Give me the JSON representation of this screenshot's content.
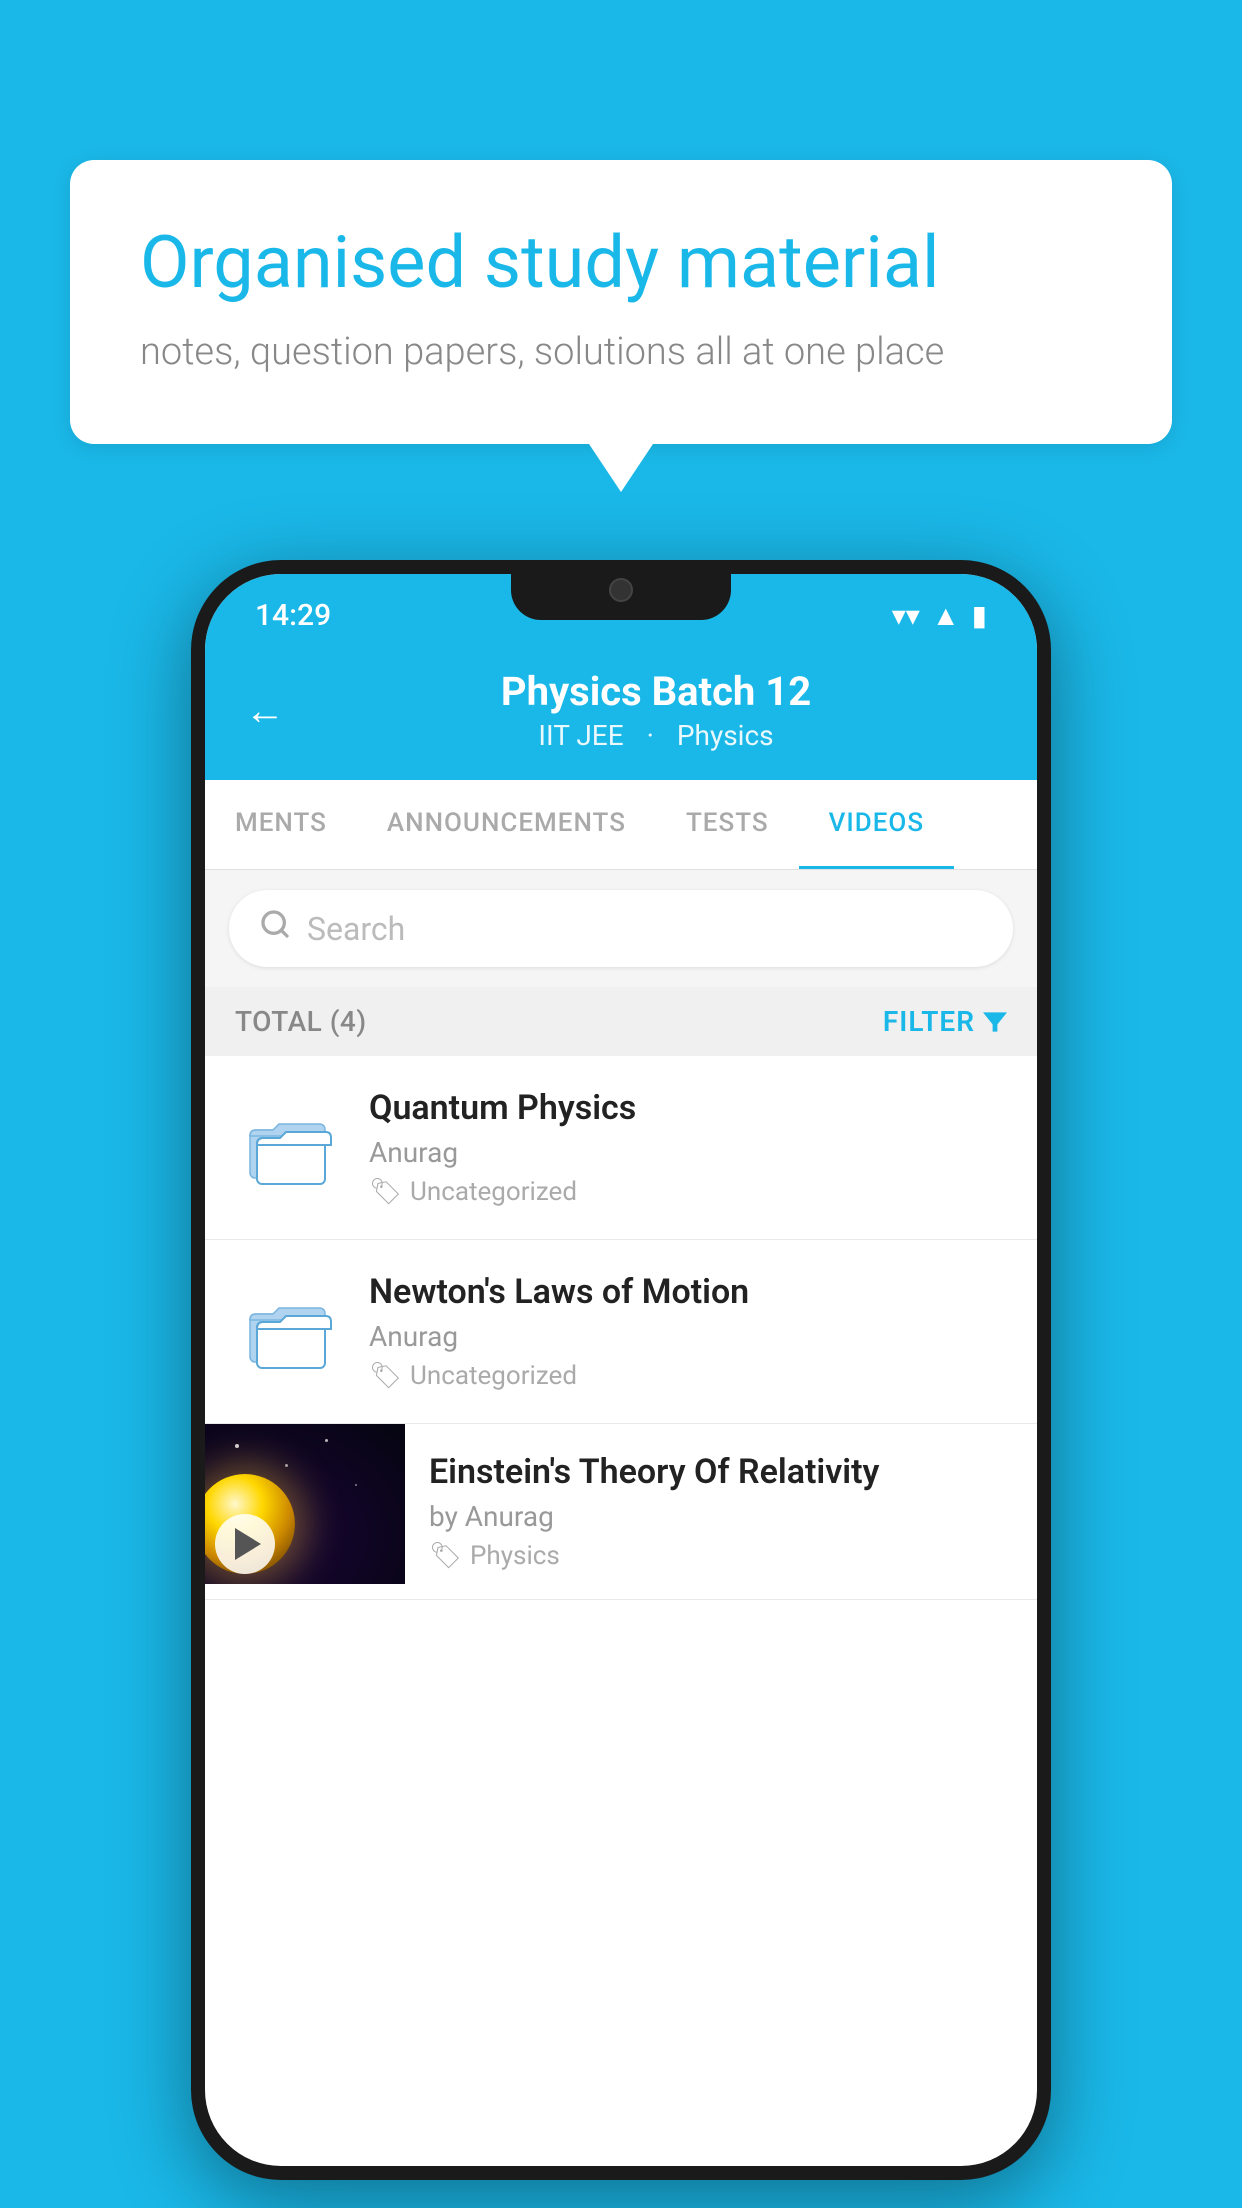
{
  "background_color": "#1ab8e8",
  "bubble": {
    "title": "Organised study material",
    "subtitle": "notes, question papers, solutions all at one place"
  },
  "phone": {
    "status_bar": {
      "time": "14:29",
      "icons": [
        "wifi",
        "signal",
        "battery"
      ]
    },
    "header": {
      "back_label": "←",
      "title": "Physics Batch 12",
      "subtitle_tag1": "IIT JEE",
      "subtitle_tag2": "Physics"
    },
    "tabs": [
      {
        "label": "MENTS",
        "active": false
      },
      {
        "label": "ANNOUNCEMENTS",
        "active": false
      },
      {
        "label": "TESTS",
        "active": false
      },
      {
        "label": "VIDEOS",
        "active": true
      }
    ],
    "search": {
      "placeholder": "Search"
    },
    "filter_bar": {
      "total_label": "TOTAL (4)",
      "filter_label": "FILTER"
    },
    "videos": [
      {
        "id": "quantum-physics",
        "title": "Quantum Physics",
        "author": "Anurag",
        "tag": "Uncategorized",
        "type": "folder",
        "has_thumb": false
      },
      {
        "id": "newtons-laws",
        "title": "Newton's Laws of Motion",
        "author": "Anurag",
        "tag": "Uncategorized",
        "type": "folder",
        "has_thumb": false
      },
      {
        "id": "einstein-relativity",
        "title": "Einstein's Theory Of Relativity",
        "author": "by Anurag",
        "tag": "Physics",
        "type": "video",
        "has_thumb": true
      }
    ]
  }
}
